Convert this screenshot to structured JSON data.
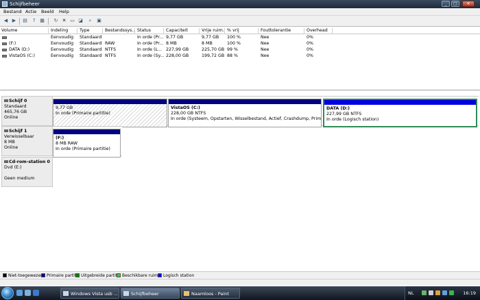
{
  "window": {
    "title": "Schijfbeheer"
  },
  "window_buttons": {
    "minimize": "_",
    "maximize": "□",
    "close": "✕"
  },
  "menu": [
    "Bestand",
    "Actie",
    "Beeld",
    "Help"
  ],
  "toolbar_icons": [
    "back-arrow-icon",
    "forward-arrow-icon",
    "volume-list-icon",
    "help-icon",
    "properties-icon",
    "refresh-icon",
    "delete-icon",
    "folder-open-icon",
    "explore-icon",
    "zoom-icon",
    "disk-view-icon"
  ],
  "volume_table": {
    "columns": [
      "Volume",
      "Indeling",
      "Type",
      "Bestandssys...",
      "Status",
      "Capaciteit",
      "Vrije ruim...",
      "% vrij",
      "Fouttolerantie",
      "Overhead"
    ],
    "rows": [
      [
        "",
        "Eenvoudig",
        "Standaard",
        "",
        "In orde (Pr...",
        "9,77 GB",
        "9,77 GB",
        "100 %",
        "Nee",
        "0%"
      ],
      [
        "(F:)",
        "Eenvoudig",
        "Standaard",
        "RAW",
        "In orde (Pr...",
        "8 MB",
        "8 MB",
        "100 %",
        "Nee",
        "0%"
      ],
      [
        "DATA (D:)",
        "Eenvoudig",
        "Standaard",
        "NTFS",
        "In orde (L...",
        "227,99 GB",
        "225,70 GB",
        "99 %",
        "Nee",
        "0%"
      ],
      [
        "VistaOS (C:)",
        "Eenvoudig",
        "Standaard",
        "NTFS",
        "In orde (Sy...",
        "228,00 GB",
        "199,72 GB",
        "88 %",
        "Nee",
        "0%"
      ]
    ]
  },
  "disks": [
    {
      "name": "Schijf 0",
      "type": "Standaard",
      "size": "465,76 GB",
      "status": "Online",
      "partitions": [
        {
          "label": "",
          "size": "9,77 GB",
          "status": "In orde (Primaire partitie)"
        },
        {
          "label": "VistaOS (C:)",
          "size": "228,00 GB NTFS",
          "status": "In orde (Systeem, Opstarten, Wisselbestand, Actief, Crashdump, Primaire pa"
        },
        {
          "label": "DATA (D:)",
          "size": "227,99 GB NTFS",
          "status": "In orde (Logisch station)"
        }
      ]
    },
    {
      "name": "Schijf 1",
      "type": "Verwisselbaar",
      "size": "8 MB",
      "status": "Online",
      "partitions": [
        {
          "label": "(F:)",
          "size": "8 MB RAW",
          "status": "In orde (Primaire partitie)"
        }
      ]
    },
    {
      "name": "Cd-rom-station 0",
      "type": "Dvd (E:)",
      "size": "",
      "status": "Geen medium",
      "partitions": []
    }
  ],
  "legend": [
    {
      "label": "Niet-toegewezen",
      "color": "#000000"
    },
    {
      "label": "Primaire partitie",
      "color": "#000080"
    },
    {
      "label": "Uitgebreide partitie",
      "color": "#008000"
    },
    {
      "label": "Beschikbare ruimte",
      "color": "#33cc33"
    },
    {
      "label": "Logisch station",
      "color": "#0000e0"
    }
  ],
  "taskbar": {
    "tasks": [
      "Windows Vista usb ...",
      "Schijfbeheer",
      "Naamloos - Paint"
    ],
    "active_task": "Schijfbeheer",
    "language": "NL",
    "clock": "16:19"
  },
  "colors": {
    "primary_partition": "#000080",
    "logical_drive": "#0000e0",
    "selection_border": "#2e8b57",
    "titlebar": "#1e2a3a"
  }
}
